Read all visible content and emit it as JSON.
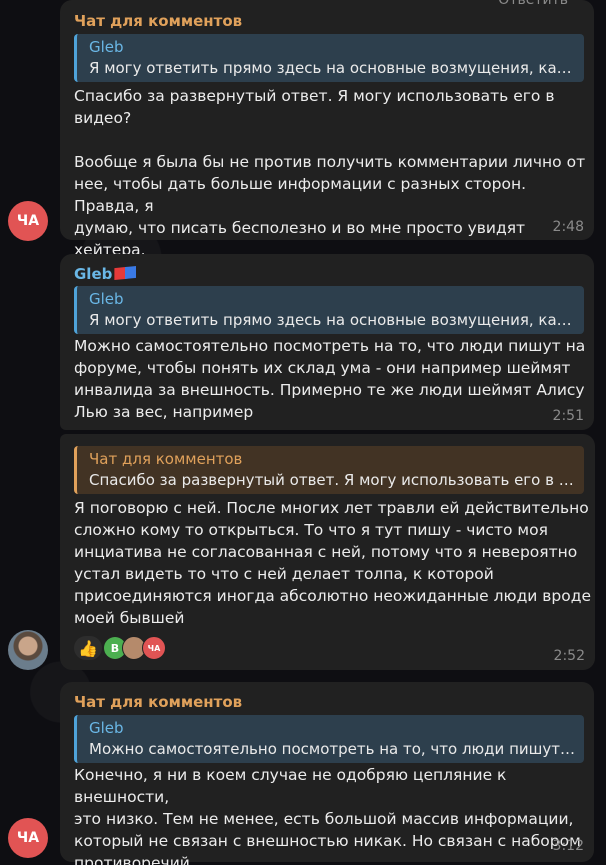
{
  "top_reply": "Ответить",
  "messages": [
    {
      "sender": "Чат для комментов",
      "quote_name": "Gleb",
      "quote_text": "Я могу ответить прямо здесь на основные возмущения, каки...",
      "text": "Спасибо за развернутый ответ. Я могу использовать его в\nвидео?\n\nВообще я была бы не против получить комментарии лично от\nнее, чтобы дать больше информации с разных сторон. Правда, я\nдумаю, что писать бесполезно и во мне просто увидят хейтера.",
      "time": "2:48",
      "avatar": "ЧА"
    },
    {
      "sender": "Gleb",
      "quote_name": "Gleb",
      "quote_text": "Я могу ответить прямо здесь на основные возмущения, каки...",
      "text": "Можно самостоятельно посмотреть на то, что люди пишут на\nфоруме, чтобы понять их склад ума - они например шеймят\nинвалида за внешность. Примерно те же люди шеймят Алису\nЛью за вес, например",
      "time": "2:51"
    },
    {
      "quote_name": "Чат для комментов",
      "quote_text": "Спасибо за развернутый ответ. Я могу использовать его в в...",
      "text": "Я поговорю с ней. После многих лет травли ей действительно\nсложно кому то открыться. То что я тут пишу - чисто моя\nинциатива не согласованная с ней, потому что я невероятно\nустал видеть то что с ней делает толпа, к которой\nприсоединяются иногда абсолютно неожиданные люди вроде\nмоей бывшей",
      "time": "2:52",
      "reactions": {
        "like": "👍",
        "v": "B",
        "ca": "ЧА"
      }
    },
    {
      "sender": "Чат для комментов",
      "quote_name": "Gleb",
      "quote_text": "Можно самостоятельно посмотреть на то, что люди пишут н...",
      "text": "Конечно, я ни в коем случае не одобряю цепляние к внешности,\nэто низко. Тем не менее, есть большой массив информации,\nкоторый не связан с внешностью никак. Но связан с набором\nпротиворечий.",
      "time": "3:12",
      "avatar": "ЧА"
    }
  ]
}
